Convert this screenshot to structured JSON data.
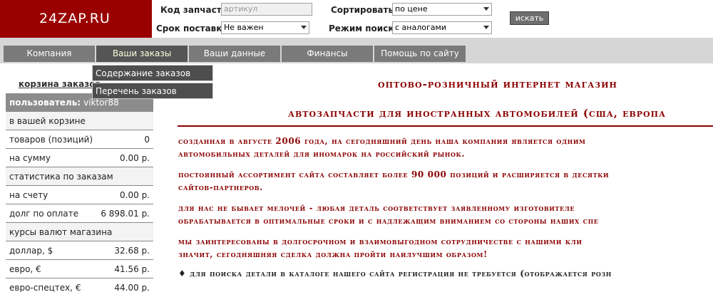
{
  "logo": {
    "text": "24ZAP.RU"
  },
  "header": {
    "part_code_label": "Код запчасти",
    "part_code_placeholder": "артикул",
    "sort_label": "Сортировать:",
    "sort_value": "по цене",
    "delivery_label": "Срок поставки",
    "delivery_value": "Не важен",
    "search_mode_label": "Режим поиска",
    "search_mode_value": "с аналогами",
    "search_button": "искать"
  },
  "nav": {
    "tabs": [
      {
        "label": "Компания"
      },
      {
        "label": "Ваши заказы"
      },
      {
        "label": "Ваши данные"
      },
      {
        "label": "Финансы"
      },
      {
        "label": "Помощь по сайту"
      }
    ],
    "dropdown": [
      {
        "label": "Содержание заказов"
      },
      {
        "label": "Перечень заказов"
      }
    ]
  },
  "sidebar": {
    "cart_link": "корзина заказов",
    "user_label": "пользователь:",
    "user_name": "viktor88",
    "cart_head": "в вашей корзине",
    "items_label": "товаров (позиций)",
    "items_value": "0",
    "sum_label": "на сумму",
    "sum_value": "0.00 р.",
    "stats_head": "статистика по заказам",
    "account_label": "на счету",
    "account_value": "0.00 р.",
    "debt_label": "долг по оплате",
    "debt_value": "6 898.01 р.",
    "rates_head": "курсы валют магазина",
    "usd_label": "доллар, $",
    "usd_value": "32.68 р.",
    "eur_label": "евро, €",
    "eur_value": "41.56 р.",
    "eur_spec_label": "евро-спецтех, €",
    "eur_spec_value": "44.00 р."
  },
  "main": {
    "title1": "Оптово-розничный интернет магазин",
    "title2": "Автозапчасти для иностранных автомобилей (США, Европа",
    "p1_line1": "созданная в августе 2006 года, на сегодняшний день наша компания является одним",
    "p1_line2": "автомобильных деталей для иномарок на российский рынок.",
    "p2_line1": "постоянный ассортимент сайта составляет более 90 000 позиций и расширяется в десятки",
    "p2_line2": "сайтов-партнеров.",
    "p3_line1": "для нас не бывает мелочей - любая деталь соответствует заявленному изготовителе",
    "p3_line2": "обрабатывается в оптимальные сроки и с надлежащим вниманием со стороны наших спе",
    "p4_line1": "мы заинтересованы в долгосрочном и взаимовыгодном сотрудничестве с нашими кли",
    "p4_line2": "значит, сегодняшняя сделка должна пройти наилучшим образом!",
    "bullet_line": "♦ для поиска детали в каталоге нашего сайта регистрация не требуется (отображается розн"
  },
  "colors": {
    "brand": "#9a0000",
    "text_accent": "#8b0000",
    "nav_tab": "#7a7a7a",
    "nav_active": "#555555"
  }
}
